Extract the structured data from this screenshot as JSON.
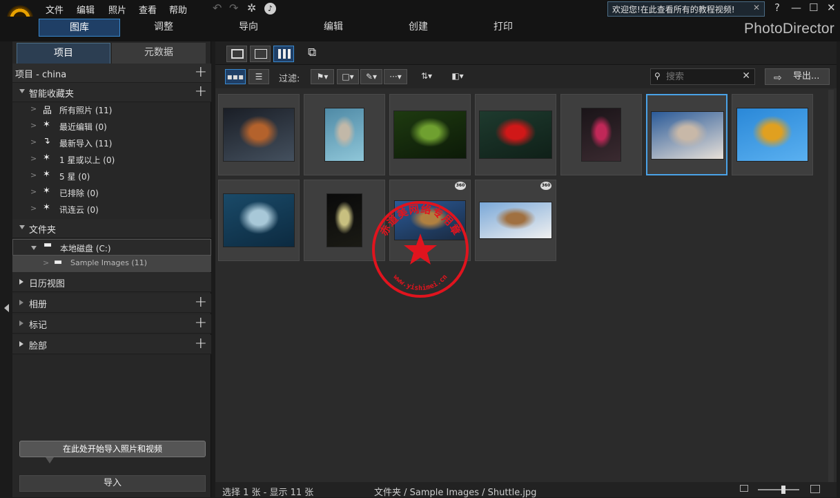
{
  "menu": [
    "文件",
    "编辑",
    "照片",
    "查看",
    "帮助"
  ],
  "welcome_text": "欢迎您!在此查看所有的教程视频!",
  "window_controls": {
    "help": "?",
    "minimize": "—",
    "maximize": "☐",
    "close": "✕"
  },
  "modules": [
    {
      "label": "图库",
      "active": true
    },
    {
      "label": "调整",
      "active": false
    },
    {
      "label": "导向",
      "active": false
    },
    {
      "label": "编辑",
      "active": false
    },
    {
      "label": "创建",
      "active": false
    },
    {
      "label": "打印",
      "active": false
    }
  ],
  "brand": "PhotoDirector",
  "left_panel": {
    "tabs": [
      "项目",
      "元数据"
    ],
    "project_title": "项目 - china",
    "smart_collections_title": "智能收藏夹",
    "smart_items": [
      {
        "icon": "hierarchy-icon",
        "label": "所有照片 (11)"
      },
      {
        "icon": "wand-icon",
        "label": "最近编辑 (0)"
      },
      {
        "icon": "import-arrow-icon",
        "label": "最新导入 (11)"
      },
      {
        "icon": "wand-icon",
        "label": "1 星或以上 (0)"
      },
      {
        "icon": "wand-icon",
        "label": "5 星 (0)"
      },
      {
        "icon": "wand-icon",
        "label": "已排除 (0)"
      },
      {
        "icon": "wand-icon",
        "label": "讯连云 (0)"
      }
    ],
    "folders_title": "文件夹",
    "drive_label": "本地磁盘 (C:)",
    "folder_label": "Sample Images (11)",
    "calendar_title": "日历视图",
    "albums_title": "相册",
    "tags_title": "标记",
    "faces_title": "脸部",
    "tip": "在此处开始导入照片和视频",
    "import_button": "导入"
  },
  "toolbar": {
    "filter_label": "过滤:",
    "search_placeholder": "搜索",
    "export_label": "导出..."
  },
  "thumbnails": [
    {
      "name": "basketball",
      "colors": [
        "#1a1e26",
        "#b4622c",
        "#44505e"
      ],
      "badge": ""
    },
    {
      "name": "rock-boat",
      "colors": [
        "#4f8aa6",
        "#c2b8a8",
        "#8fc6d8"
      ],
      "badge": ""
    },
    {
      "name": "forest",
      "colors": [
        "#1e3a10",
        "#6fa030",
        "#0c1a08"
      ],
      "badge": ""
    },
    {
      "name": "maple-leaf",
      "colors": [
        "#1e3a2e",
        "#d01818",
        "#0f2018"
      ],
      "badge": ""
    },
    {
      "name": "neon-store",
      "colors": [
        "#1a1418",
        "#c02858",
        "#3a2a30"
      ],
      "badge": ""
    },
    {
      "name": "shuttle",
      "colors": [
        "#2a5a98",
        "#c8b8a8",
        "#e8e0d8"
      ],
      "badge": ""
    },
    {
      "name": "skater",
      "colors": [
        "#2a88d8",
        "#e0a020",
        "#5ab0f0"
      ],
      "badge": ""
    },
    {
      "name": "wave",
      "colors": [
        "#1a4a68",
        "#a8c8d8",
        "#0c2a40"
      ],
      "badge": ""
    },
    {
      "name": "window-light",
      "colors": [
        "#0a0a0a",
        "#c8c080",
        "#1a1a14"
      ],
      "badge": ""
    },
    {
      "name": "panorama-city",
      "colors": [
        "#2a5a98",
        "#b08040",
        "#1a2a40"
      ],
      "badge": "360"
    },
    {
      "name": "panorama-crater",
      "colors": [
        "#7aa8d8",
        "#a07040",
        "#f0f0f0"
      ],
      "badge": "360"
    }
  ],
  "status": {
    "selection": "选择 1 张 - 显示 11 张",
    "path": "文件夹 / Sample Images / Shuttle.jpg"
  },
  "watermark": {
    "top_text": "赤道美网络专用章",
    "bottom_text": "www.yishimei.cn",
    "color": "#e0141e"
  }
}
